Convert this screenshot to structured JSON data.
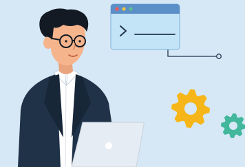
{
  "colors": {
    "background": "#d6e8f5",
    "terminal_bar": "#5b8fc7",
    "terminal_body": "#c3e4f7",
    "dot_red": "#ef5a5a",
    "dot_yellow": "#f5c242",
    "dot_green": "#5cc28a",
    "prompt_stroke": "#20334d",
    "gear_large": "#f6b619",
    "gear_small": "#42b79c",
    "jacket": "#1f3248",
    "shirt": "#ffffff",
    "hair": "#141a24",
    "skin": "#f6b48d",
    "laptop": "#e6ecf3"
  },
  "icons": {
    "terminal": "terminal-window-icon",
    "gear_large": "gear-icon",
    "gear_small": "gear-icon",
    "laptop_logo": "apple-logo-icon"
  }
}
